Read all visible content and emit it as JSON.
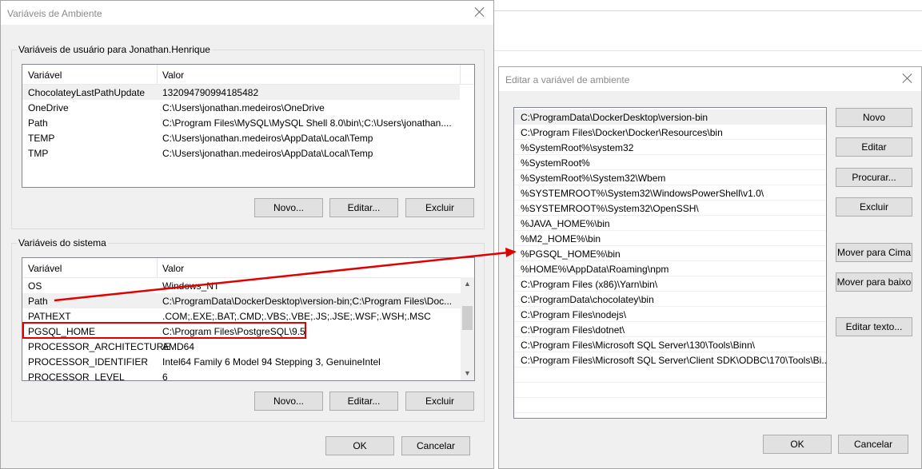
{
  "env_dialog": {
    "title": "Variáveis de Ambiente",
    "user_group_label": "Variáveis de usuário para Jonathan.Henrique",
    "system_group_label": "Variáveis do sistema",
    "col_variable": "Variável",
    "col_value": "Valor",
    "user_vars": [
      {
        "name": "ChocolateyLastPathUpdate",
        "value": "132094790994185482"
      },
      {
        "name": "OneDrive",
        "value": "C:\\Users\\jonathan.medeiros\\OneDrive"
      },
      {
        "name": "Path",
        "value": "C:\\Program Files\\MySQL\\MySQL Shell 8.0\\bin\\;C:\\Users\\jonathan...."
      },
      {
        "name": "TEMP",
        "value": "C:\\Users\\jonathan.medeiros\\AppData\\Local\\Temp"
      },
      {
        "name": "TMP",
        "value": "C:\\Users\\jonathan.medeiros\\AppData\\Local\\Temp"
      }
    ],
    "system_vars": [
      {
        "name": "OS",
        "value": "Windows_NT"
      },
      {
        "name": "Path",
        "value": "C:\\ProgramData\\DockerDesktop\\version-bin;C:\\Program Files\\Doc..."
      },
      {
        "name": "PATHEXT",
        "value": ".COM;.EXE;.BAT;.CMD;.VBS;.VBE;.JS;.JSE;.WSF;.WSH;.MSC"
      },
      {
        "name": "PGSQL_HOME",
        "value": "C:\\Program Files\\PostgreSQL\\9.5"
      },
      {
        "name": "PROCESSOR_ARCHITECTURE",
        "value": "AMD64"
      },
      {
        "name": "PROCESSOR_IDENTIFIER",
        "value": "Intel64 Family 6 Model 94 Stepping 3, GenuineIntel"
      },
      {
        "name": "PROCESSOR_LEVEL",
        "value": "6"
      }
    ],
    "btn_new": "Novo...",
    "btn_edit": "Editar...",
    "btn_delete": "Excluir",
    "btn_ok": "OK",
    "btn_cancel": "Cancelar"
  },
  "edit_dialog": {
    "title": "Editar a variável de ambiente",
    "entries": [
      "C:\\ProgramData\\DockerDesktop\\version-bin",
      "C:\\Program Files\\Docker\\Docker\\Resources\\bin",
      "%SystemRoot%\\system32",
      "%SystemRoot%",
      "%SystemRoot%\\System32\\Wbem",
      "%SYSTEMROOT%\\System32\\WindowsPowerShell\\v1.0\\",
      "%SYSTEMROOT%\\System32\\OpenSSH\\",
      "%JAVA_HOME%\\bin",
      "%M2_HOME%\\bin",
      "%PGSQL_HOME%\\bin",
      "%HOME%\\AppData\\Roaming\\npm",
      "C:\\Program Files (x86)\\Yarn\\bin\\",
      "C:\\ProgramData\\chocolatey\\bin",
      "C:\\Program Files\\nodejs\\",
      "C:\\Program Files\\dotnet\\",
      "C:\\Program Files\\Microsoft SQL Server\\130\\Tools\\Binn\\",
      "C:\\Program Files\\Microsoft SQL Server\\Client SDK\\ODBC\\170\\Tools\\Bi..."
    ],
    "btn_new": "Novo",
    "btn_edit": "Editar",
    "btn_browse": "Procurar...",
    "btn_delete": "Excluir",
    "btn_move_up": "Mover para Cima",
    "btn_move_down": "Mover para baixo",
    "btn_edit_text": "Editar texto...",
    "btn_ok": "OK",
    "btn_cancel": "Cancelar"
  },
  "annotation_color": "#e00000"
}
